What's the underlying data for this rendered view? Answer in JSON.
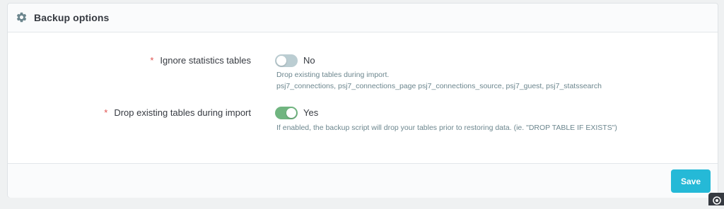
{
  "panel": {
    "title": "Backup options",
    "icon": "gear-icon"
  },
  "options": [
    {
      "required_mark": "*",
      "label": "Ignore statistics tables",
      "enabled": false,
      "state_label": "No",
      "help_line1": "Drop existing tables during import.",
      "help_line2": "psj7_connections, psj7_connections_page psj7_connections_source, psj7_guest, psj7_statssearch"
    },
    {
      "required_mark": "*",
      "label": "Drop existing tables during import",
      "enabled": true,
      "state_label": "Yes",
      "help_line1": "If enabled, the backup script will drop your tables prior to restoring data. (ie. \"DROP TABLE IF EXISTS\")"
    }
  ],
  "footer": {
    "save_label": "Save"
  },
  "colors": {
    "accent": "#25b9d7",
    "switch_on": "#70b580",
    "switch_off": "#bbcdd2",
    "required": "#e0524f"
  }
}
